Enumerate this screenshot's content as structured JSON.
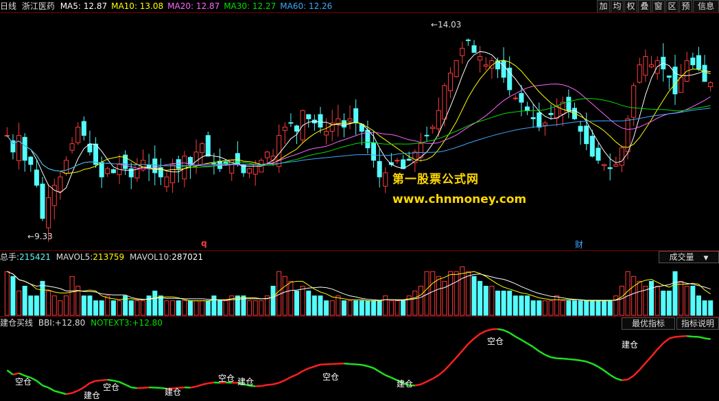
{
  "header": {
    "period": "日线",
    "stock": "浙江医药",
    "ma": [
      {
        "label": "MA5:",
        "value": "12.87",
        "color": "#ffffff"
      },
      {
        "label": "MA10:",
        "value": "13.08",
        "color": "#ffff00"
      },
      {
        "label": "MA20:",
        "value": "12.87",
        "color": "#ff66ff"
      },
      {
        "label": "MA30:",
        "value": "12.27",
        "color": "#00e000"
      },
      {
        "label": "MA60:",
        "value": "12.26",
        "color": "#3fa9ff"
      }
    ]
  },
  "toolbar": [
    "加",
    "均",
    "权",
    "叠",
    "窗",
    "区",
    "预",
    "信息"
  ],
  "price_panel": {
    "high_label": "14.03",
    "low_label": "9.33",
    "marker_q": "q",
    "marker_cai": "财",
    "watermark_cn": "第一股票公式网",
    "watermark_url": "www.chnmoney.com",
    "ylim": [
      9.0,
      14.4
    ]
  },
  "volume_panel": {
    "total_label": "总手:",
    "total_value": "215421",
    "mavol5_label": "MAVOL5:",
    "mavol5_value": "213759",
    "mavol10_label": "MAVOL10:",
    "mavol10_value": "287021",
    "dropdown": "成交量"
  },
  "indicator_panel": {
    "name": "建仓买线",
    "bbi_label": "BBI:",
    "bbi_value": "+12.80",
    "notext_label": "NOTEXT3:",
    "notext_value": "+12.80",
    "btn_best": "最优指标",
    "btn_help": "指标说明",
    "tags": [
      {
        "text": "空仓",
        "x": 22,
        "y": 548
      },
      {
        "text": "建仓",
        "x": 122,
        "y": 568
      },
      {
        "text": "空仓",
        "x": 150,
        "y": 556
      },
      {
        "text": "建仓",
        "x": 240,
        "y": 563
      },
      {
        "text": "空仓",
        "x": 318,
        "y": 543
      },
      {
        "text": "建仓",
        "x": 346,
        "y": 548
      },
      {
        "text": "空仓",
        "x": 470,
        "y": 541
      },
      {
        "text": "建仓",
        "x": 578,
        "y": 551
      },
      {
        "text": "空仓",
        "x": 710,
        "y": 489
      },
      {
        "text": "建仓",
        "x": 906,
        "y": 494
      }
    ]
  },
  "colors": {
    "up": "#ff3c3c",
    "down": "#54fcfc",
    "frame": "#7a0000"
  },
  "chart_data": {
    "type": "candlestick",
    "closes": [
      11.6,
      11.2,
      11.6,
      11.0,
      10.9,
      10.4,
      9.6,
      10.1,
      10.4,
      10.6,
      11.0,
      11.4,
      11.8,
      11.6,
      11.2,
      10.9,
      10.6,
      10.8,
      10.7,
      10.9,
      10.8,
      10.6,
      10.9,
      11.0,
      10.8,
      10.7,
      10.6,
      10.6,
      10.9,
      10.8,
      11.1,
      10.9,
      11.2,
      11.4,
      11.1,
      10.9,
      10.8,
      10.9,
      11.0,
      10.9,
      10.7,
      10.8,
      10.9,
      11.0,
      11.2,
      11.1,
      11.6,
      11.8,
      11.9,
      11.7,
      12.2,
      12.0,
      11.9,
      11.8,
      11.7,
      11.9,
      12.0,
      11.8,
      12.0,
      11.9,
      11.7,
      11.3,
      11.0,
      10.6,
      10.7,
      10.9,
      11.0,
      10.8,
      11.0,
      11.2,
      11.4,
      11.6,
      11.8,
      12.2,
      12.8,
      13.1,
      13.4,
      13.7,
      13.9,
      13.6,
      13.5,
      13.3,
      13.4,
      13.2,
      13.0,
      12.7,
      12.5,
      12.4,
      12.2,
      12.0,
      11.8,
      11.9,
      12.1,
      12.3,
      12.4,
      12.2,
      12.0,
      11.7,
      11.4,
      11.1,
      11.0,
      10.9,
      10.8,
      10.9,
      11.3,
      12.0,
      12.8,
      13.3,
      13.5,
      13.3,
      13.4,
      13.2,
      13.0,
      12.6,
      13.0,
      13.4,
      13.3,
      13.2,
      12.9,
      12.87
    ],
    "ma5_last": 12.87,
    "ma10_last": 13.08,
    "ma20_last": 12.87,
    "ma30_last": 12.27,
    "ma60_last": 12.26,
    "volumes": [
      9,
      8,
      5,
      6,
      4,
      4,
      7,
      5,
      4,
      3,
      4,
      8,
      6,
      4,
      4,
      3,
      3,
      4,
      3,
      3,
      4,
      3,
      3,
      3,
      4,
      5,
      4,
      3,
      3,
      3,
      3,
      3,
      3,
      3,
      3,
      4,
      3,
      3,
      4,
      4,
      4,
      3,
      3,
      3,
      4,
      6,
      9,
      8,
      7,
      5,
      6,
      5,
      4,
      4,
      3,
      3,
      4,
      3,
      3,
      3,
      3,
      3,
      3,
      3,
      4,
      3,
      3,
      3,
      4,
      5,
      6,
      9,
      9,
      8,
      7,
      9,
      9,
      10,
      9,
      8,
      7,
      6,
      6,
      5,
      5,
      5,
      4,
      4,
      4,
      3,
      3,
      3,
      3,
      4,
      3,
      3,
      3,
      3,
      3,
      3,
      3,
      3,
      3,
      4,
      6,
      9,
      8,
      7,
      6,
      7,
      6,
      5,
      5,
      9,
      7,
      6,
      6,
      4,
      3,
      3
    ]
  }
}
